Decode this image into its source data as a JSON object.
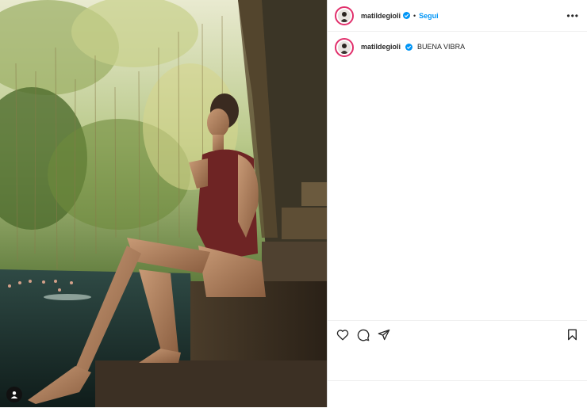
{
  "post": {
    "username": "matildegioli",
    "follow_label": "Segui",
    "separator": "•",
    "more_label": "•••",
    "caption_text": "BUENA VIBRA"
  },
  "photo": {
    "icon": "user-icon"
  },
  "actions": {
    "icons": [
      "heart-icon",
      "comment-icon",
      "share-icon",
      "bookmark-icon"
    ]
  },
  "colors": {
    "link": "#0095f6",
    "story_ring": "#e1306c",
    "verified": "#0095f6"
  }
}
